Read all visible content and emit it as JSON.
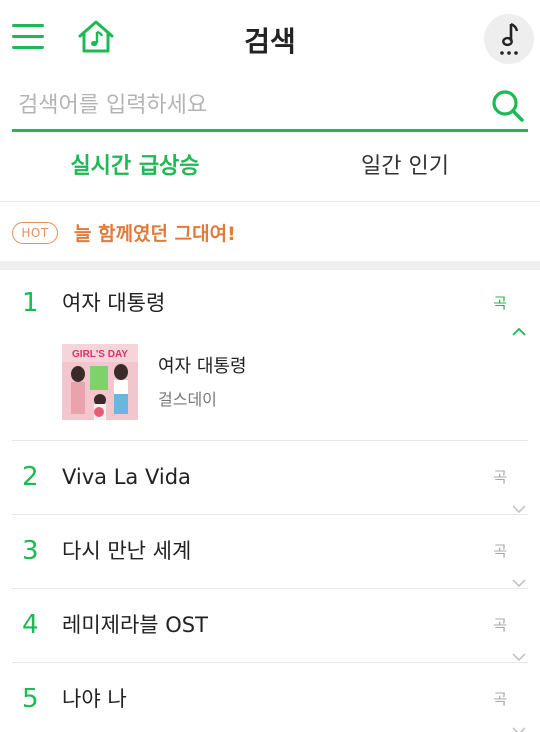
{
  "header": {
    "title": "검색",
    "menu_icon": "hamburger-menu-icon",
    "home_icon": "music-home-icon",
    "player_icon": "music-note-icon"
  },
  "search": {
    "placeholder": "검색어를 입력하세요",
    "value": "",
    "icon": "search-icon"
  },
  "tabs": [
    {
      "label": "실시간 급상승",
      "active": true
    },
    {
      "label": "일간 인기",
      "active": false
    }
  ],
  "hot": {
    "badge": "HOT",
    "text": "늘 함께였던 그대여!"
  },
  "ranking": [
    {
      "rank": "1",
      "title": "여자 대통령",
      "type": "곡",
      "expanded": true,
      "song": {
        "title": "여자 대통령",
        "artist": "걸스데이",
        "album_badge": "GIRL'S DAY"
      }
    },
    {
      "rank": "2",
      "title": "Viva La Vida",
      "type": "곡",
      "expanded": false
    },
    {
      "rank": "3",
      "title": "다시 만난 세계",
      "type": "곡",
      "expanded": false
    },
    {
      "rank": "4",
      "title": "레미제라블 OST",
      "type": "곡",
      "expanded": false
    },
    {
      "rank": "5",
      "title": "나야 나",
      "type": "곡",
      "expanded": false
    }
  ],
  "colors": {
    "accent": "#1db954",
    "hot": "#e07b3d",
    "muted": "#a8a8a8"
  }
}
